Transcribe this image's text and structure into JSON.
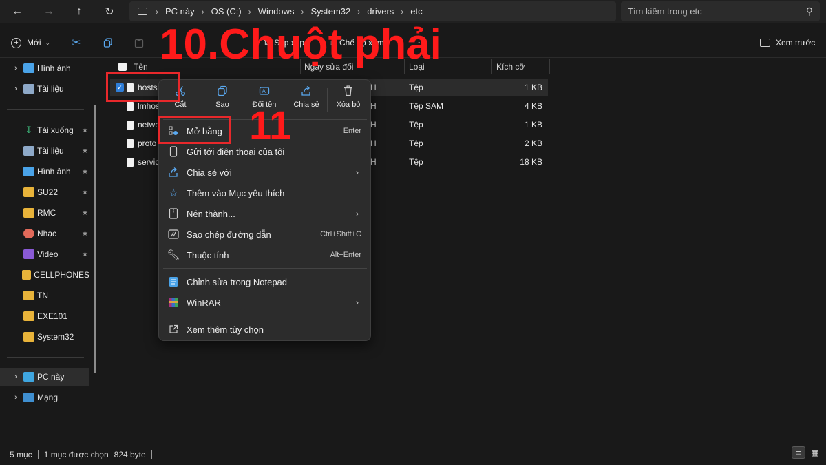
{
  "breadcrumb": [
    "PC này",
    "OS (C:)",
    "Windows",
    "System32",
    "drivers",
    "etc"
  ],
  "search": {
    "placeholder": "Tìm kiếm trong etc"
  },
  "toolbar": {
    "new_label": "Mới",
    "sort_label": "Sắp xếp",
    "view_label": "Chế độ xem",
    "preview_label": "Xem trước"
  },
  "sidebar": {
    "top_items": [
      {
        "label": "Hình ảnh"
      },
      {
        "label": "Tài liệu"
      }
    ],
    "pinned": [
      {
        "label": "Tải xuống"
      },
      {
        "label": "Tài liệu"
      },
      {
        "label": "Hình ảnh"
      },
      {
        "label": "SU22"
      },
      {
        "label": "RMC"
      },
      {
        "label": "Nhạc"
      },
      {
        "label": "Video"
      },
      {
        "label": "CELLPHONES"
      },
      {
        "label": "TN"
      },
      {
        "label": "EXE101"
      },
      {
        "label": "System32"
      }
    ],
    "bottom_items": [
      {
        "label": "PC này"
      },
      {
        "label": "Mạng"
      }
    ]
  },
  "columns": {
    "name": "Tên",
    "date": "Ngày sửa đổi",
    "type": "Loại",
    "size": "Kích cỡ"
  },
  "files": [
    {
      "name": "hosts",
      "date_tail": "H",
      "type": "Tệp",
      "size": "1 KB"
    },
    {
      "name": "lmhos",
      "date_tail": "H",
      "type": "Tệp SAM",
      "size": "4 KB"
    },
    {
      "name": "netwo",
      "date_tail": "H",
      "type": "Tệp",
      "size": "1 KB"
    },
    {
      "name": "proto",
      "date_tail": "H",
      "type": "Tệp",
      "size": "2 KB"
    },
    {
      "name": "service",
      "date_tail": "H",
      "type": "Tệp",
      "size": "18 KB"
    }
  ],
  "context_menu": {
    "quick_actions": [
      {
        "label": "Cắt",
        "icon": "scissors-icon"
      },
      {
        "label": "Sao",
        "icon": "copy-icon"
      },
      {
        "label": "Đổi tên",
        "icon": "rename-icon"
      },
      {
        "label": "Chia sẻ",
        "icon": "share-icon"
      },
      {
        "label": "Xóa bỏ",
        "icon": "trash-icon"
      }
    ],
    "items": [
      {
        "label": "Mở bằng",
        "shortcut": "Enter"
      },
      {
        "label": "Gửi tới điện thoại của tôi",
        "shortcut": ""
      },
      {
        "label": "Chia sẻ với",
        "shortcut": ""
      },
      {
        "label": "Thêm vào Mục yêu thích",
        "shortcut": ""
      },
      {
        "label": "Nén thành...",
        "shortcut": ""
      },
      {
        "label": "Sao chép đường dẫn",
        "shortcut": "Ctrl+Shift+C"
      },
      {
        "label": "Thuộc tính",
        "shortcut": "Alt+Enter"
      },
      {
        "label": "Chỉnh sửa trong Notepad",
        "shortcut": ""
      },
      {
        "label": "WinRAR",
        "shortcut": ""
      },
      {
        "label": "Xem thêm tùy chọn",
        "shortcut": ""
      }
    ]
  },
  "annotations": {
    "step_title": "10.Chuột phải",
    "step_number": "11"
  },
  "status": {
    "count": "5 mục",
    "selected": "1 mục được chọn",
    "size": "824 byte"
  },
  "colors": {
    "accent": "#2f7ed8",
    "annotation_red": "#ff1a1a",
    "folder": "#e8b33a"
  }
}
